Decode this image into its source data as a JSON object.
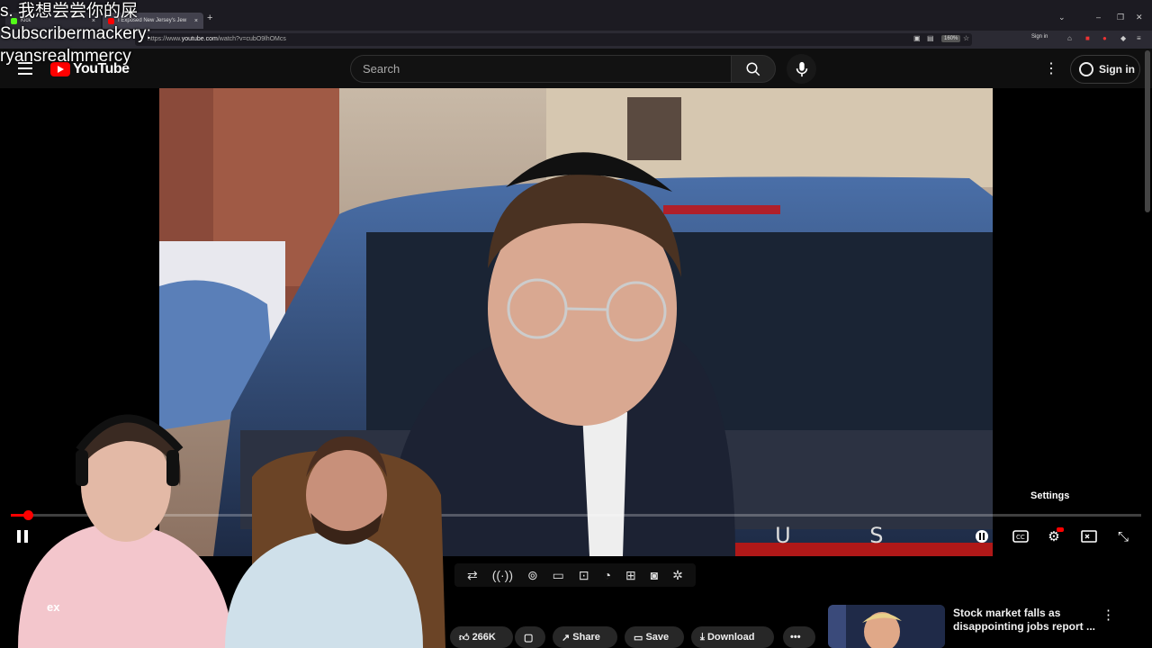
{
  "overlay": {
    "line1": "s. 我想尝尝你的屎",
    "line2": "Subscribermackery:",
    "line3": "ryansrealmmercy"
  },
  "browser": {
    "tabs": [
      {
        "title": "Kick",
        "color": "#53fc18"
      },
      {
        "title": "I Exposed New Jersey's Jew",
        "color": "#ff0000"
      }
    ],
    "url_prefix": "https://www.",
    "url_host": "youtube.com",
    "url_path": "/watch?v=cubO9lhOMcs",
    "zoom": "160%",
    "sign_in": "Sign in"
  },
  "header": {
    "logo_text": "YouTube",
    "search_placeholder": "Search",
    "sign_in_label": "Sign in"
  },
  "player": {
    "progress_fraction": 0.015,
    "settings_tooltip": "Settings",
    "plate_text": "X U S"
  },
  "below": {
    "likes": "266K",
    "share": "Share",
    "save": "Save",
    "download": "Download",
    "more": "•••",
    "chat_letter": "ex"
  },
  "recommendation": {
    "title": "Stock market falls as disappointing jobs report ..."
  },
  "colors": {
    "yt_red": "#ff0000",
    "bg": "#0f0f0f"
  }
}
